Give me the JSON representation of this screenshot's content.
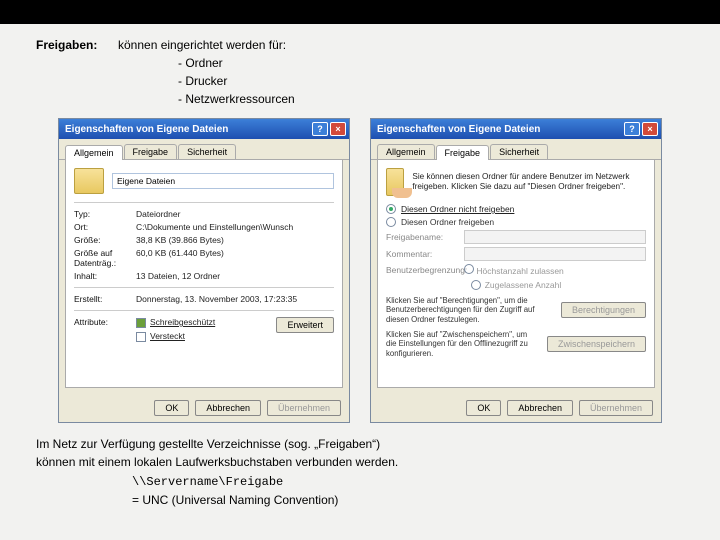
{
  "intro": {
    "label": "Freigaben:",
    "text": "können eingerichtet werden für:",
    "bullets": [
      "-  Ordner",
      "-  Drucker",
      "-  Netzwerkressourcen"
    ]
  },
  "dialog": {
    "title": "Eigenschaften von Eigene Dateien",
    "tabs": {
      "general": "Allgemein",
      "share": "Freigabe",
      "security": "Sicherheit"
    },
    "buttons": {
      "ok": "OK",
      "cancel": "Abbrechen",
      "apply": "Übernehmen",
      "advanced": "Erweitert",
      "perms": "Berechtigungen",
      "cache": "Zwischenspeichern"
    }
  },
  "general": {
    "name_value": "Eigene Dateien",
    "rows": {
      "typ": {
        "k": "Typ:",
        "v": "Dateiordner"
      },
      "ort": {
        "k": "Ort:",
        "v": "C:\\Dokumente und Einstellungen\\Wunsch"
      },
      "groesse": {
        "k": "Größe:",
        "v": "38,8 KB (39.866 Bytes)"
      },
      "disk": {
        "k": "Größe auf Datenträg.:",
        "v": "60,0 KB (61.440 Bytes)"
      },
      "inhalt": {
        "k": "Inhalt:",
        "v": "13 Dateien, 12 Ordner"
      },
      "erstellt": {
        "k": "Erstellt:",
        "v": "Donnerstag, 13. November 2003, 17:23:35"
      }
    },
    "attr_label": "Attribute:",
    "attr_readonly": "Schreibgeschützt",
    "attr_hidden": "Versteckt"
  },
  "share": {
    "desc": "Sie können diesen Ordner für andere Benutzer im Netzwerk freigeben. Klicken Sie dazu auf \"Diesen Ordner freigeben\".",
    "radio_noshare": "Diesen Ordner nicht freigeben",
    "radio_share": "Diesen Ordner freigeben",
    "field_name": "Freigabename:",
    "field_comment": "Kommentar:",
    "limit_label": "Benutzerbegrenzung:",
    "limit_opt": "Höchstanzahl zulassen",
    "limit_allow": "Zugelassene Anzahl",
    "perm_text": "Klicken Sie auf \"Berechtigungen\", um die Benutzerberechtigungen für den Zugriff auf diesen Ordner festzulegen.",
    "cache_text": "Klicken Sie auf \"Zwischenspeichern\", um die Einstellungen für den Offlinezugriff zu konfigurieren."
  },
  "outro": {
    "line1": "Im Netz zur Verfügung gestellte Verzeichnisse (sog. „Freigaben“)",
    "line2": "können mit einem lokalen Laufwerksbuchstaben verbunden werden.",
    "unc1": "\\\\Servername\\Freigabe",
    "unc2": "= UNC (Universal Naming Convention)"
  }
}
